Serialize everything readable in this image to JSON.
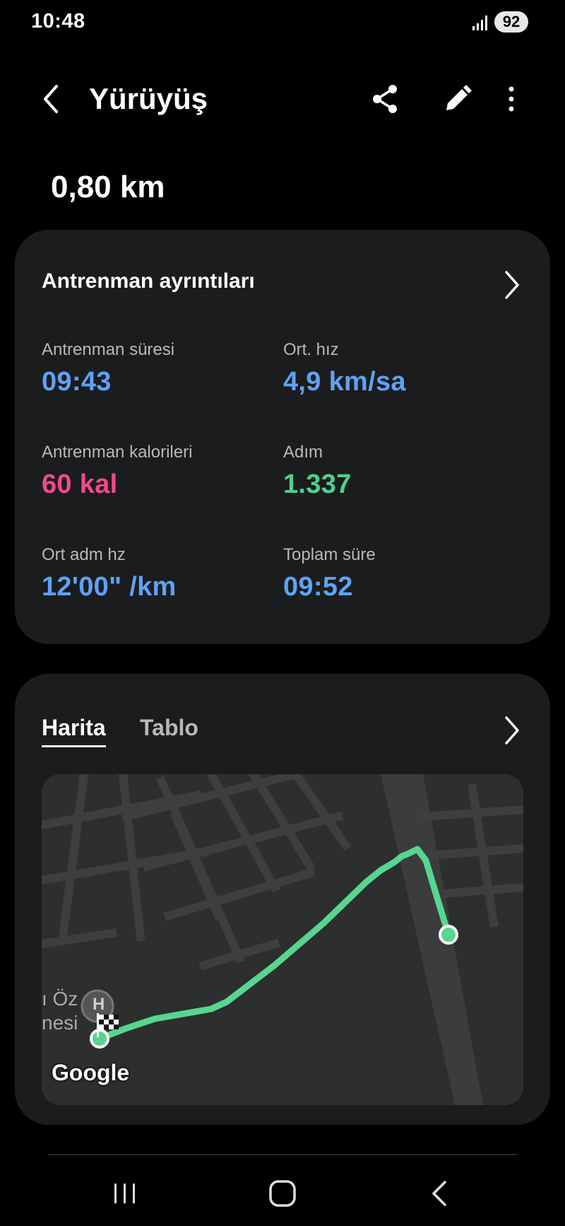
{
  "status_bar": {
    "time": "10:48",
    "battery": "92",
    "icons": [
      "signal-icon"
    ]
  },
  "header": {
    "title": "Yürüyüş",
    "icons": [
      "back-icon",
      "share-icon",
      "edit-icon",
      "more-icon"
    ]
  },
  "distance": "0,80 km",
  "details": {
    "title": "Antrenman ayrıntıları",
    "stats": [
      {
        "label": "Antrenman süresi",
        "value": "09:43",
        "color": "#5ea2f6"
      },
      {
        "label": "Ort. hız",
        "value": "4,9 km/sa",
        "color": "#5ea2f6"
      },
      {
        "label": "Antrenman kalorileri",
        "value": "60 kal",
        "color": "#f04a8c"
      },
      {
        "label": "Adım",
        "value": "1.337",
        "color": "#4fd08b"
      },
      {
        "label": "Ort adm hz",
        "value": "12'00\" /km",
        "color": "#5ea2f6"
      },
      {
        "label": "Toplam süre",
        "value": "09:52",
        "color": "#5ea2f6"
      }
    ]
  },
  "map_card": {
    "tabs": [
      {
        "label": "Harita",
        "active": true
      },
      {
        "label": "Tablo",
        "active": false
      }
    ],
    "map_labels": {
      "line1": "ı Öz",
      "line2": "nesi",
      "poi": "H"
    },
    "attribution": "Google",
    "route_color": "#56d68f"
  },
  "nav_bar": {
    "icons": [
      "recents-icon",
      "home-icon",
      "back-nav-icon"
    ]
  }
}
